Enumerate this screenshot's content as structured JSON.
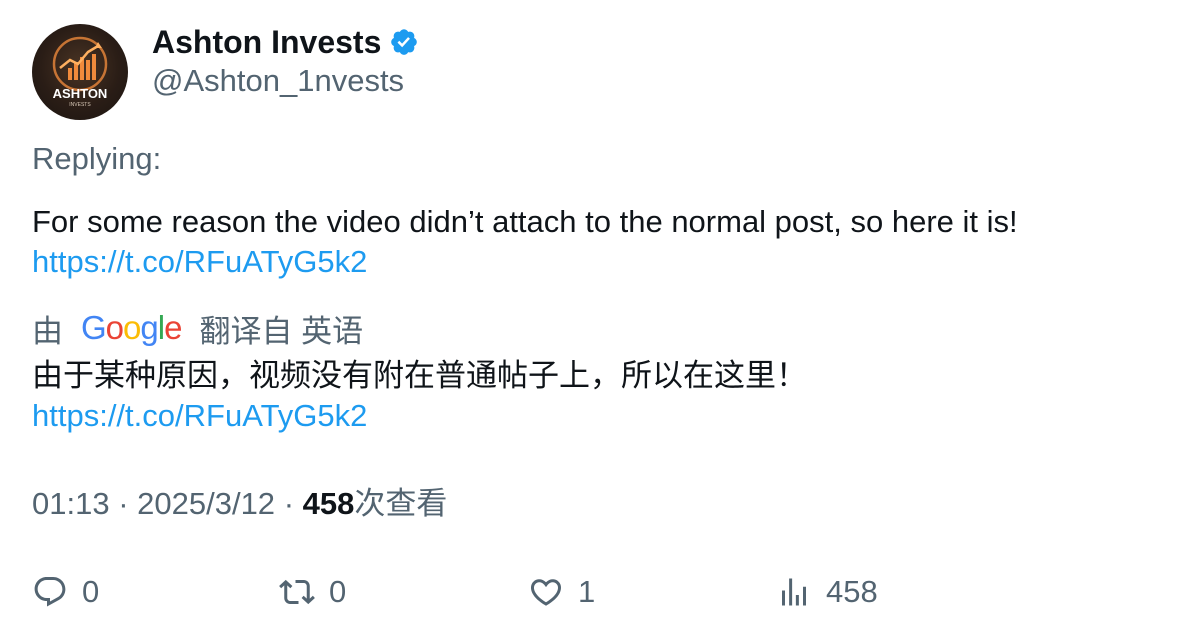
{
  "author": {
    "display_name": "Ashton Invests",
    "handle": "@Ashton_1nvests",
    "verified": true,
    "avatar_text": "ASHTON",
    "avatar_subtext": "INVESTS"
  },
  "reply_label": "Replying:",
  "tweet": {
    "text": "For some reason the video didn’t attach to the normal post, so here it is!",
    "link": "https://t.co/RFuATyG5k2"
  },
  "translation": {
    "prefix": "由",
    "provider": "Google",
    "suffix": "翻译自 英语",
    "text": "由于某种原因，视频没有附在普通帖子上，所以在这里！",
    "link": "https://t.co/RFuATyG5k2"
  },
  "meta": {
    "time": "01:13",
    "date": "2025/3/12",
    "views": "458",
    "views_label": "次查看"
  },
  "actions": {
    "replies": "0",
    "retweets": "0",
    "likes": "1",
    "views": "458"
  },
  "colors": {
    "link": "#1d9bf0",
    "secondary_text": "#536471",
    "primary_text": "#0f1419",
    "verified_badge": "#1d9bf0"
  }
}
